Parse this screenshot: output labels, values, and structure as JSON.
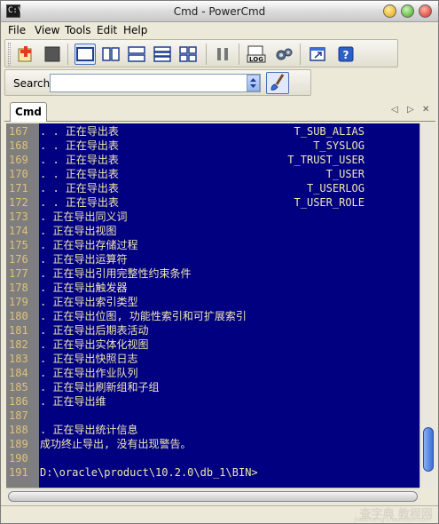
{
  "window": {
    "title": "Cmd - PowerCmd",
    "app_icon_text": "C:\\"
  },
  "menu": [
    "File",
    "View",
    "Tools",
    "Edit",
    "Help"
  ],
  "toolbar": {
    "buttons": [
      {
        "name": "new-console-icon"
      },
      {
        "name": "stop-icon"
      },
      {
        "name": "layout-single-icon"
      },
      {
        "name": "layout-vertical-split-icon"
      },
      {
        "name": "layout-horizontal-split-icon"
      },
      {
        "name": "layout-three-rows-icon"
      },
      {
        "name": "layout-grid-icon"
      },
      {
        "name": "pause-icon"
      },
      {
        "name": "log-icon"
      },
      {
        "name": "settings-gears-icon"
      },
      {
        "name": "external-window-icon"
      },
      {
        "name": "help-icon"
      }
    ],
    "log_label": "LOG"
  },
  "search": {
    "label": "Search",
    "value": ""
  },
  "tabs": [
    {
      "label": "Cmd"
    }
  ],
  "console": {
    "lines": [
      {
        "num": "167",
        "text": ". . 正在导出表",
        "right": "T_SUB_ALIAS"
      },
      {
        "num": "168",
        "text": ". . 正在导出表",
        "right": "T_SYSLOG"
      },
      {
        "num": "169",
        "text": ". . 正在导出表",
        "right": "T_TRUST_USER"
      },
      {
        "num": "170",
        "text": ". . 正在导出表",
        "right": "T_USER"
      },
      {
        "num": "171",
        "text": ". . 正在导出表",
        "right": "T_USERLOG"
      },
      {
        "num": "172",
        "text": ". . 正在导出表",
        "right": "T_USER_ROLE"
      },
      {
        "num": "173",
        "text": ". 正在导出同义词",
        "right": ""
      },
      {
        "num": "174",
        "text": ". 正在导出视图",
        "right": ""
      },
      {
        "num": "175",
        "text": ". 正在导出存储过程",
        "right": ""
      },
      {
        "num": "176",
        "text": ". 正在导出运算符",
        "right": ""
      },
      {
        "num": "177",
        "text": ". 正在导出引用完整性约束条件",
        "right": ""
      },
      {
        "num": "178",
        "text": ". 正在导出触发器",
        "right": ""
      },
      {
        "num": "179",
        "text": ". 正在导出索引类型",
        "right": ""
      },
      {
        "num": "180",
        "text": ". 正在导出位图, 功能性索引和可扩展索引",
        "right": ""
      },
      {
        "num": "181",
        "text": ". 正在导出后期表活动",
        "right": ""
      },
      {
        "num": "182",
        "text": ". 正在导出实体化视图",
        "right": ""
      },
      {
        "num": "183",
        "text": ". 正在导出快照日志",
        "right": ""
      },
      {
        "num": "184",
        "text": ". 正在导出作业队列",
        "right": ""
      },
      {
        "num": "185",
        "text": ". 正在导出刷新组和子组",
        "right": ""
      },
      {
        "num": "186",
        "text": ". 正在导出维",
        "right": ""
      },
      {
        "num": "187",
        "text": "",
        "right": ""
      },
      {
        "num": "188",
        "text": ". 正在导出统计信息",
        "right": ""
      },
      {
        "num": "189",
        "text": "成功终止导出, 没有出现警告。",
        "right": ""
      },
      {
        "num": "190",
        "text": "",
        "right": ""
      },
      {
        "num": "191",
        "text": "D:\\oracle\\product\\10.2.0\\db_1\\BIN>",
        "right": ""
      }
    ]
  },
  "watermark": {
    "text": "查字典 教程网",
    "sub": "jiaocheng.chazidian.com"
  }
}
